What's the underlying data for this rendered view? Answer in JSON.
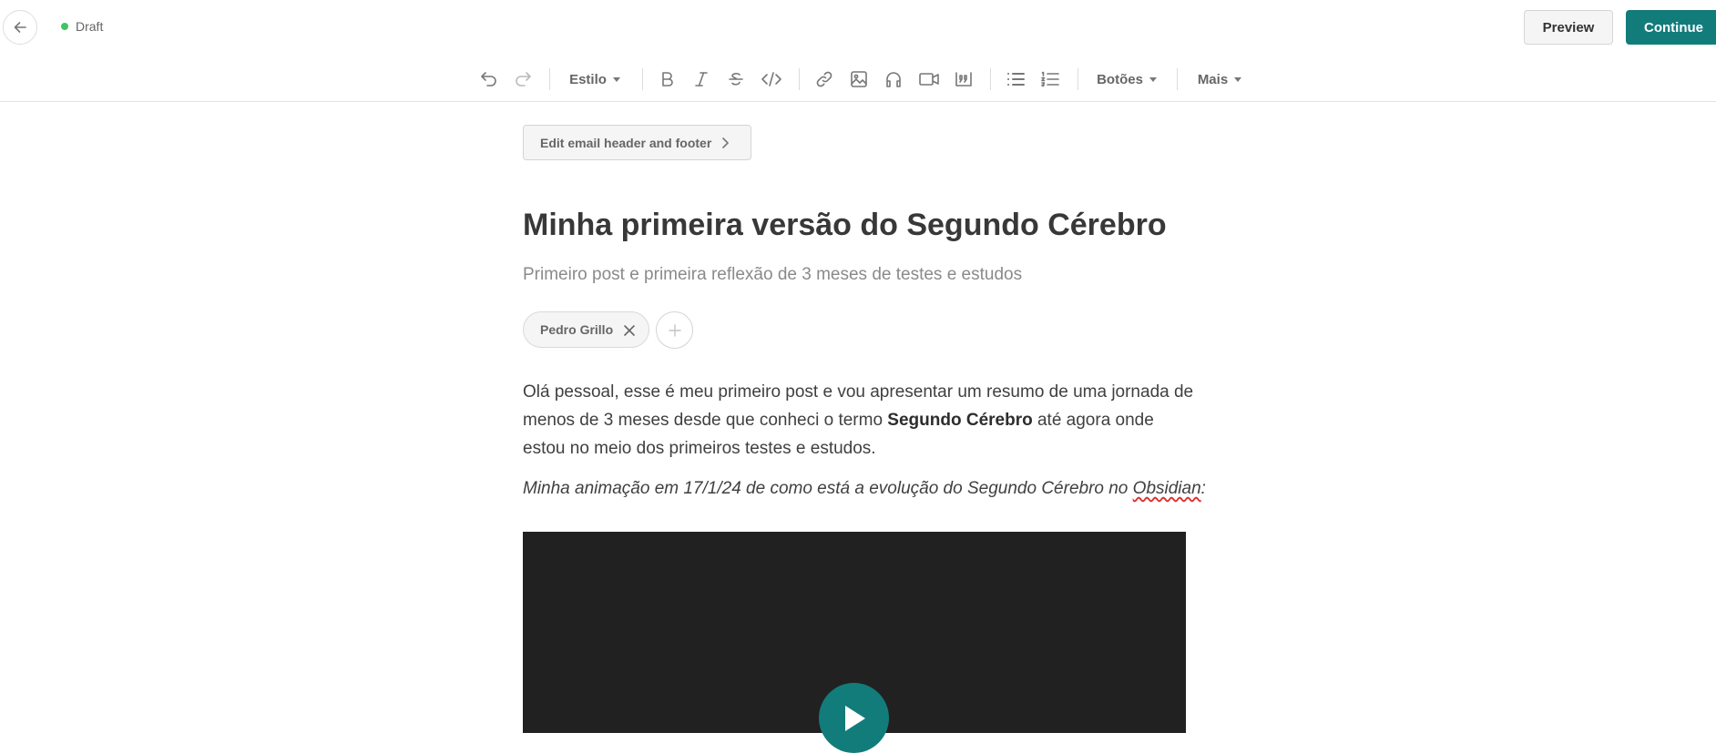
{
  "header": {
    "status": "Draft",
    "status_color": "#41c463",
    "preview_label": "Preview",
    "continue_label": "Continue",
    "accent_color": "#127c7b",
    "back_icon": "arrow-left-icon"
  },
  "toolbar": {
    "undo_icon": "undo-icon",
    "redo_icon": "redo-icon",
    "style_label": "Estilo",
    "bold_icon": "bold-icon",
    "italic_icon": "italic-icon",
    "strikethrough_icon": "strikethrough-icon",
    "code_icon": "code-icon",
    "link_icon": "link-icon",
    "image_icon": "image-icon",
    "audio_icon": "headphones-icon",
    "video_icon": "video-camera-icon",
    "quote_icon": "quote-icon",
    "bullet_list_icon": "bullet-list-icon",
    "numbered_list_icon": "numbered-list-icon",
    "buttons_label": "Botões",
    "more_label": "Mais"
  },
  "editor": {
    "edit_header_footer_label": "Edit email header and footer",
    "title": "Minha primeira versão do Segundo Cérebro",
    "subtitle": "Primeiro post e primeira reflexão de 3 meses de testes e estudos",
    "author": "Pedro Grillo",
    "paragraph": {
      "before": "Olá pessoal, esse é meu primeiro post e vou apresentar um resumo de uma jornada de menos de 3 meses desde que conheci o termo ",
      "bold": "Segundo Cérebro",
      "after": " até agora onde estou no meio dos primeiros testes e estudos."
    },
    "caption": {
      "text": "Minha animação em 17/1/24 de como está a evolução do Segundo Cérebro no ",
      "misspelled": "Obsidian",
      "end": ":"
    },
    "video_play_icon": "play-icon"
  }
}
